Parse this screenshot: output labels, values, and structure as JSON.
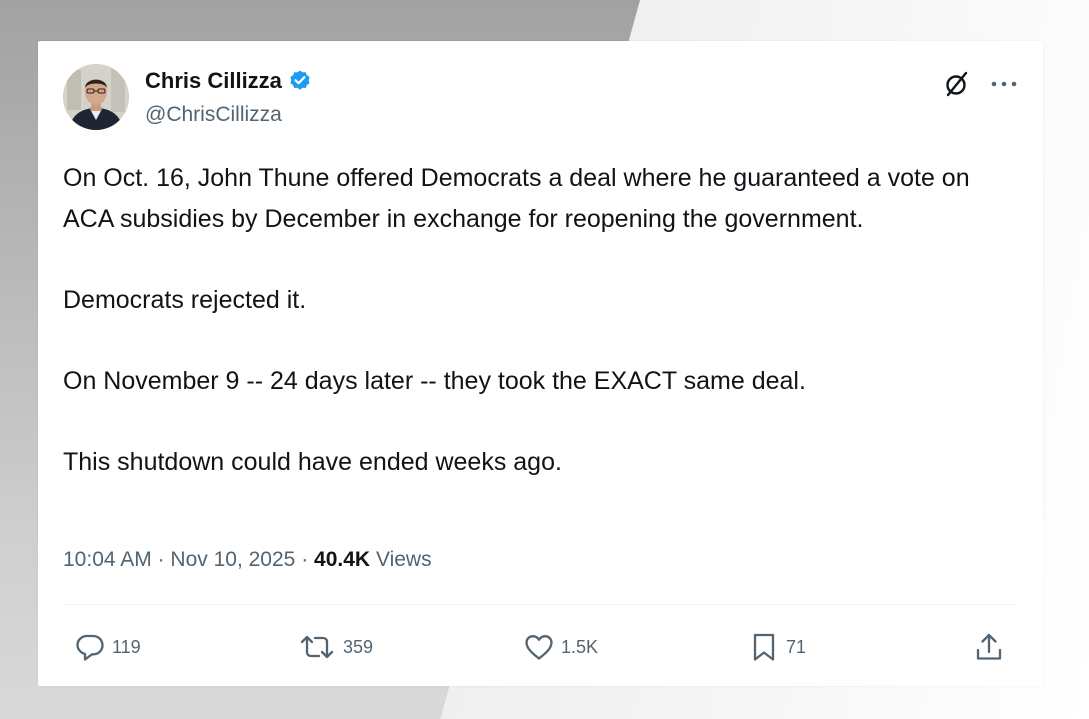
{
  "author": {
    "name": "Chris Cillizza",
    "handle": "@ChrisCillizza",
    "verified": true
  },
  "tweet": {
    "paragraphs": [
      "On Oct. 16, John Thune offered Democrats a deal where he guaranteed a vote on ACA subsidies by December in exchange for reopening the government.",
      "Democrats rejected it.",
      "On November 9 -- 24 days later -- they took the EXACT same deal.",
      "This shutdown could have ended weeks ago."
    ],
    "time": "10:04 AM",
    "date": "Nov 10, 2025",
    "separator": "·",
    "views_count": "40.4K",
    "views_label": "Views"
  },
  "actions": {
    "replies": "119",
    "reposts": "359",
    "likes": "1.5K",
    "bookmarks": "71"
  },
  "icons": {
    "verified": "verified-badge-icon",
    "grok": "grok-icon",
    "more": "more-icon",
    "reply": "reply-icon",
    "repost": "repost-icon",
    "like": "like-icon",
    "bookmark": "bookmark-icon",
    "share": "share-icon"
  },
  "colors": {
    "verified_blue": "#1d9bf0",
    "text_primary": "#0f1419",
    "text_secondary": "#536471"
  }
}
